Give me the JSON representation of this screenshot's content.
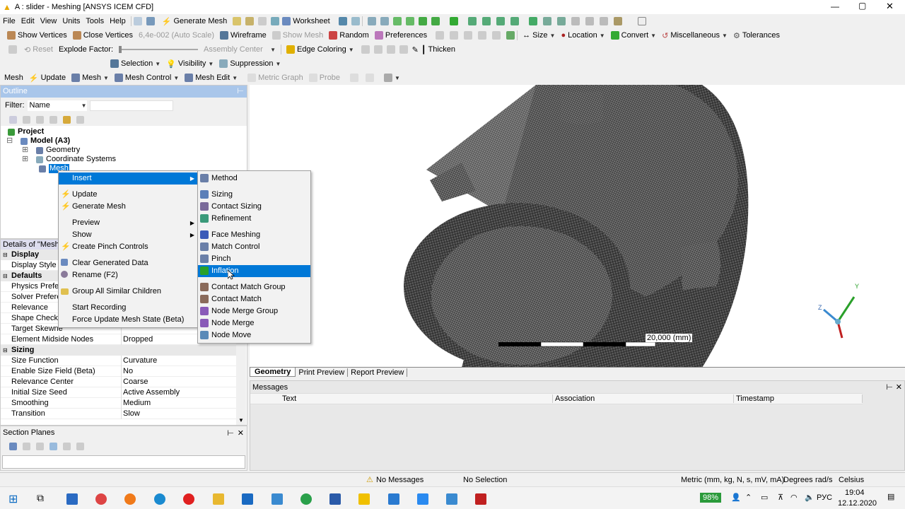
{
  "title": "A : slider - Meshing [ANSYS ICEM CFD]",
  "menu": [
    "File",
    "Edit",
    "View",
    "Units",
    "Tools",
    "Help"
  ],
  "tb1": {
    "generate_mesh": "Generate Mesh",
    "worksheet": "Worksheet"
  },
  "tb2": {
    "show_vertices": "Show Vertices",
    "close_vertices": "Close Vertices",
    "scale": "6,4e-002 (Auto Scale)",
    "wireframe": "Wireframe",
    "show_mesh": "Show Mesh",
    "random": "Random",
    "preferences": "Preferences",
    "size": "Size",
    "location": "Location",
    "convert": "Convert",
    "misc": "Miscellaneous",
    "tolerances": "Tolerances"
  },
  "tb3": {
    "reset": "Reset",
    "explode": "Explode Factor:",
    "assembly": "Assembly Center",
    "edge_coloring": "Edge Coloring",
    "thicken": "Thicken"
  },
  "tb4": {
    "selection": "Selection",
    "visibility": "Visibility",
    "suppression": "Suppression"
  },
  "tb5": {
    "mesh": "Mesh",
    "update": "Update",
    "mesh2": "Mesh",
    "mesh_control": "Mesh Control",
    "mesh_edit": "Mesh Edit",
    "metric_graph": "Metric Graph",
    "probe": "Probe"
  },
  "outline": {
    "title": "Outline",
    "filter_label": "Filter:",
    "filter_value": "Name"
  },
  "tree": {
    "project": "Project",
    "model": "Model (A3)",
    "geometry": "Geometry",
    "coord": "Coordinate Systems",
    "mesh": "Mesh"
  },
  "context_menu": [
    {
      "label": "Insert",
      "submenu": true,
      "icon": "none"
    },
    {
      "label": "Update",
      "icon": "lightning-icon"
    },
    {
      "label": "Generate Mesh",
      "icon": "lightning-icon"
    },
    {
      "label": "Preview",
      "submenu": true,
      "icon": "none"
    },
    {
      "label": "Show",
      "submenu": true,
      "icon": "none"
    },
    {
      "label": "Create Pinch Controls",
      "icon": "lightning-icon"
    },
    {
      "label": "Clear Generated Data",
      "icon": "clear-icon"
    },
    {
      "label": "Rename (F2)",
      "icon": "rename-icon"
    },
    {
      "label": "Group All Similar Children",
      "icon": "folder-icon"
    },
    {
      "label": "Start Recording",
      "icon": "none"
    },
    {
      "label": "Force Update Mesh State (Beta)",
      "icon": "none"
    }
  ],
  "submenu": [
    {
      "label": "Method",
      "color": "#6a7fa8"
    },
    {
      "label": "Sizing",
      "color": "#5b7fb8"
    },
    {
      "label": "Contact Sizing",
      "color": "#7a6a9a"
    },
    {
      "label": "Refinement",
      "color": "#3a9a7a"
    },
    {
      "label": "Face Meshing",
      "color": "#3a5ab8"
    },
    {
      "label": "Match Control",
      "color": "#6a7fa8"
    },
    {
      "label": "Pinch",
      "color": "#6a7fa8"
    },
    {
      "label": "Inflation",
      "color": "#2aa02a"
    },
    {
      "label": "Contact Match Group",
      "color": "#8a6a5a"
    },
    {
      "label": "Contact Match",
      "color": "#8a6a5a"
    },
    {
      "label": "Node Merge Group",
      "color": "#8a5ab8"
    },
    {
      "label": "Node Merge",
      "color": "#8a5ab8"
    },
    {
      "label": "Node Move",
      "color": "#5a8ab8"
    }
  ],
  "details": {
    "title": "Details of \"Mesh\"",
    "rows": [
      {
        "label": "Display",
        "cat": true
      },
      {
        "label": "Display Style",
        "value": ""
      },
      {
        "label": "Defaults",
        "cat": true
      },
      {
        "label": "Physics Prefere",
        "value": ""
      },
      {
        "label": "Solver Preferen",
        "value": ""
      },
      {
        "label": "Relevance",
        "value": ""
      },
      {
        "label": "Shape Checkin",
        "value": ""
      },
      {
        "label": "Target Skewne",
        "value": ""
      },
      {
        "label": "Element Midside Nodes",
        "value": "Dropped"
      },
      {
        "label": "Sizing",
        "cat": true
      },
      {
        "label": "Size Function",
        "value": "Curvature"
      },
      {
        "label": "Enable Size Field (Beta)",
        "value": "No"
      },
      {
        "label": "Relevance Center",
        "value": "Coarse"
      },
      {
        "label": "Initial Size Seed",
        "value": "Active Assembly"
      },
      {
        "label": "Smoothing",
        "value": "Medium"
      },
      {
        "label": "Transition",
        "value": "Slow"
      }
    ]
  },
  "section_planes": {
    "title": "Section Planes"
  },
  "viewport": {
    "scale_label": "20,000 (mm)",
    "axis_y": "Y",
    "axis_z": "Z"
  },
  "view_tabs": [
    "Geometry",
    "Print Preview",
    "Report Preview"
  ],
  "messages": {
    "title": "Messages",
    "columns": [
      "Text",
      "Association",
      "Timestamp"
    ]
  },
  "status": {
    "messages": "No Messages",
    "selection": "No Selection",
    "units": "Metric (mm, kg, N, s, mV, mA)",
    "degrees": "Degrees",
    "rads": "rad/s",
    "temp": "Celsius"
  },
  "taskbar": {
    "battery": "98%",
    "lang": "РУС",
    "time": "19:04",
    "date": "12.12.2020"
  }
}
